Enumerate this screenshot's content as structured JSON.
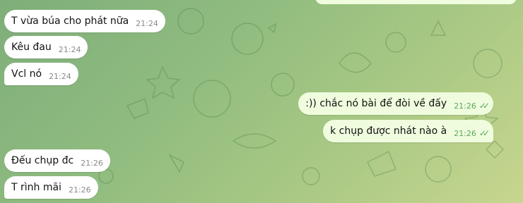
{
  "messages": [
    {
      "text": "T vừa búa cho phát nữa",
      "time": "21:24",
      "direction": "in"
    },
    {
      "text": "Kêu đau",
      "time": "21:24",
      "direction": "in"
    },
    {
      "text": "Vcl nó",
      "time": "21:24",
      "direction": "in"
    },
    {
      "text": ":)) chắc nó bài để đòi về đấy",
      "time": "21:26",
      "direction": "out",
      "status": "read"
    },
    {
      "text": "k chụp được nhát nào à",
      "time": "21:26",
      "direction": "out",
      "status": "read"
    },
    {
      "text": "Đếu chụp đc",
      "time": "21:26",
      "direction": "in"
    },
    {
      "text": "T rình mãi",
      "time": "21:26",
      "direction": "in"
    }
  ],
  "icons": {
    "read_receipt": "double-check-icon"
  },
  "colors": {
    "incoming_bubble": "#ffffff",
    "outgoing_bubble": "#effdde",
    "accent": "#5aa65b"
  }
}
